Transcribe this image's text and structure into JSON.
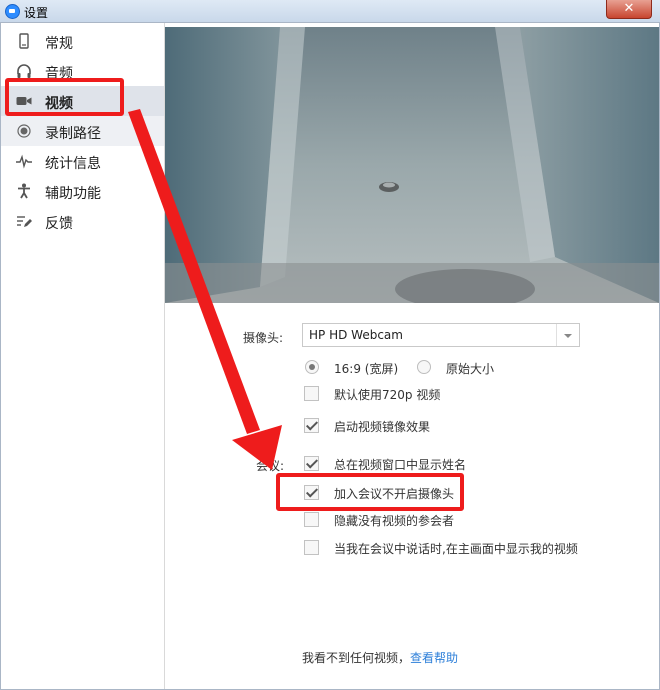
{
  "window": {
    "title": "设置",
    "close_label": "✕"
  },
  "sidebar": {
    "items": [
      {
        "label": "常规",
        "icon": "phone-icon"
      },
      {
        "label": "音频",
        "icon": "headphones-icon"
      },
      {
        "label": "视频",
        "icon": "video-camera-icon",
        "selected": true
      },
      {
        "label": "录制路径",
        "icon": "record-icon"
      },
      {
        "label": "统计信息",
        "icon": "pulse-icon"
      },
      {
        "label": "辅助功能",
        "icon": "accessibility-icon"
      },
      {
        "label": "反馈",
        "icon": "feedback-icon"
      }
    ]
  },
  "video": {
    "camera_label": "摄像头:",
    "camera_value": "HP HD Webcam",
    "aspect_options": [
      {
        "label": "16:9 (宽屏)",
        "selected": true
      },
      {
        "label": "原始大小",
        "selected": false
      }
    ],
    "hd_label": "默认使用720p 视频",
    "hd_checked": false,
    "mirror_label": "启动视频镜像效果",
    "mirror_checked": true,
    "meeting_label": "会议:",
    "meeting_options": [
      {
        "label": "总在视频窗口中显示姓名",
        "checked": true
      },
      {
        "label": "加入会议不开启摄像头",
        "checked": true
      },
      {
        "label": "隐藏没有视频的参会者",
        "checked": false
      },
      {
        "label": "当我在会议中说话时,在主画面中显示我的视频",
        "checked": false
      }
    ]
  },
  "footer": {
    "text": "我看不到任何视频，",
    "link": "查看帮助"
  },
  "colors": {
    "annotation": "#ee1c1c",
    "accent": "#2d7fd9",
    "selected_bg": "#dfe3ea"
  }
}
